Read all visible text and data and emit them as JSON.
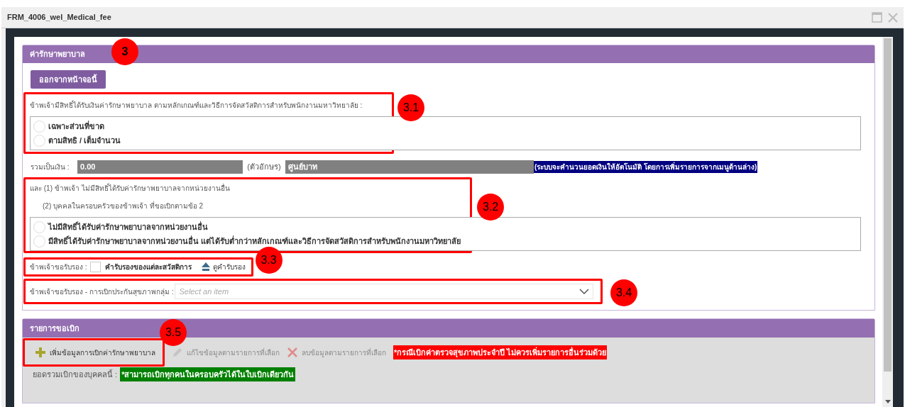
{
  "window": {
    "title": "FRM_4006_wel_Medical_fee"
  },
  "panel": {
    "title": "ค่ารักษาพยาบาล",
    "exit_button": "ออกจากหน้าจอนี้",
    "entitlement": {
      "label": "ข้าพเจ้ามีสิทธิ์ได้รับเงินค่ารักษาพยาบาล ตามหลักเกณฑ์และวิธีการจัดสวัสดิการสำหรับพนักงานมหาวิทยาลัย :",
      "options": [
        {
          "label": "เฉพาะส่วนที่ขาด",
          "selected": false
        },
        {
          "label": "ตามสิทธิ / เต็มจำนวน",
          "selected": false
        }
      ]
    },
    "total": {
      "label": "รวมเป็นเงิน :",
      "amount": "0.00",
      "words_label": "(ตัวอักษร)",
      "words": "ศูนย์บาท",
      "note": "(ระบบจะคำนวนยอดเงินให้อัตโนมัติ โดยการเพิ่มรายการจากเมนูด้านล่าง)"
    },
    "other_rights": {
      "line_1": "และ (1) ข้าพเจ้า ไม่มีสิทธิ์ได้รับค่ารักษาพยาบาลจากหน่วยงานอื่น",
      "line_2": "(2) บุคคลในครอบครัวของข้าพเจ้า ที่ขอเบิกตามข้อ 2",
      "options": [
        {
          "label": "ไม่มีสิทธิ์ได้รับค่ารักษาพยาบาลจากหน่วยงานอื่น",
          "selected": false
        },
        {
          "label": "มีสิทธิ์ได้รับค่ารักษาพยาบาลจากหน่วยงานอื่น แต่ได้รับต่ำกว่าหลักเกณฑ์และวิธีการจัดสวัสดิการสำหรับพนักงานมหาวิทยาลัย",
          "selected": false
        }
      ]
    },
    "certify": {
      "label": "ข้าพเจ้าขอรับรอง :",
      "checked": false,
      "checkbox_label": "คำรับรองของแต่ละสวัสดิการ",
      "link": "ดูคำรับรอง"
    },
    "group_insurance": {
      "label": "ข้าพเจ้าขอรับรอง - การเบิกประกันสุขภาพกลุ่ม :",
      "placeholder": "Select an item"
    }
  },
  "claims_panel": {
    "title": "รายการขอเบิก",
    "toolbar": [
      {
        "kind": "add",
        "label": "เพิ่มข้อมูลการเบิกค่ารักษาพยาบาล",
        "disabled": false
      },
      {
        "kind": "edit",
        "label": "แก้ไขข้อมูลตามรายการที่เลือก",
        "disabled": true
      },
      {
        "kind": "delete",
        "label": "ลบข้อมูลตามรายการที่เลือก",
        "disabled": true
      }
    ],
    "warning": "*กรณีเบิกค่าตรวจสุขภาพประจำปี ไม่ควรเพิ่มรายการอื่นร่วมด้วย",
    "summary_label": "ยอดรวมเบิกของบุคคลนี้ :",
    "summary_note": "*สามารถเบิกทุกคนในครอบครัวได้ในใบเบิกเดียวกัน"
  },
  "annotations": [
    "3",
    "3.1",
    "3.2",
    "3.3",
    "3.4",
    "3.5"
  ]
}
